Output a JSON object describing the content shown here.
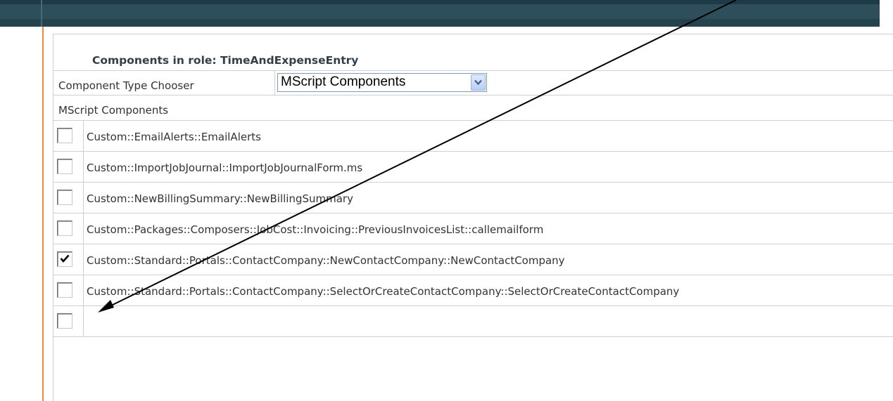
{
  "panel": {
    "title": "Components in role: TimeAndExpenseEntry",
    "chooser_label": "Component Type Chooser",
    "chooser_value": "MScript Components",
    "section_header": "MScript Components"
  },
  "components": [
    {
      "label": "Custom::EmailAlerts::EmailAlerts",
      "checked": false
    },
    {
      "label": "Custom::ImportJobJournal::ImportJobJournalForm.ms",
      "checked": false
    },
    {
      "label": "Custom::NewBillingSummary::NewBillingSummary",
      "checked": false
    },
    {
      "label": "Custom::Packages::Composers::JobCost::Invoicing::PreviousInvoicesList::callemailform",
      "checked": false
    },
    {
      "label": "Custom::Standard::Portals::ContactCompany::NewContactCompany::NewContactCompany",
      "checked": true
    },
    {
      "label": "Custom::Standard::Portals::ContactCompany::SelectOrCreateContactCompany::SelectOrCreateContactCompany",
      "checked": false
    },
    {
      "label": "",
      "checked": false
    }
  ],
  "colors": {
    "header_band": "#2e4e5b",
    "left_rule": "#f08a3c",
    "annotation_arrow": "#000000"
  }
}
